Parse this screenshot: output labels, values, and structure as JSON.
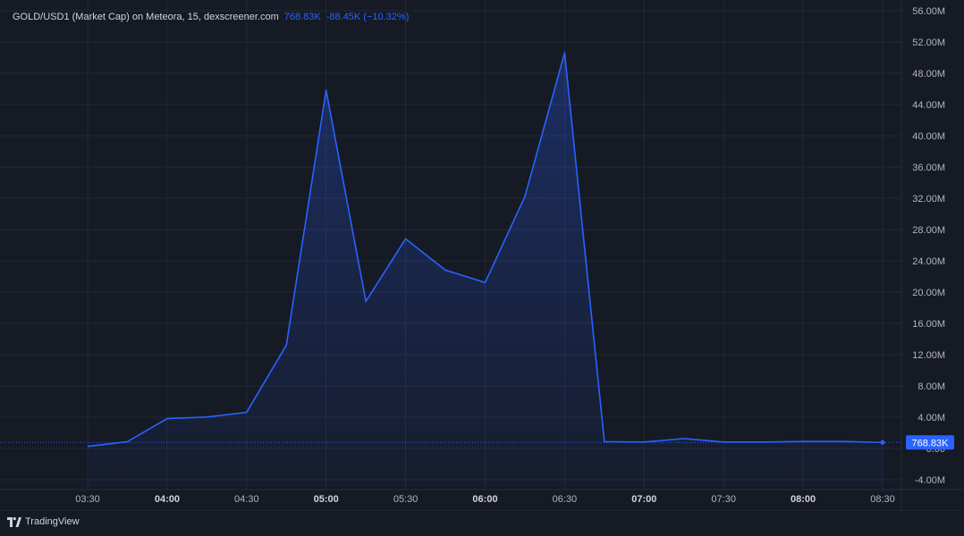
{
  "legend": {
    "symbol": "GOLD/USD1 (Market Cap) on Meteora, 15, dexscreener.com",
    "value": "768.83K",
    "change": "-88.45K (−10.32%)"
  },
  "brand": {
    "name": "TradingView"
  },
  "colors": {
    "background": "#161a25",
    "line": "#2962ff",
    "grid": "#232838",
    "axis_text": "#b2b5be",
    "price_label_bg": "#2962ff"
  },
  "chart_data": {
    "type": "area",
    "title": "",
    "x": [
      "03:30",
      "03:45",
      "04:00",
      "04:15",
      "04:30",
      "04:45",
      "05:00",
      "05:15",
      "05:30",
      "05:45",
      "06:00",
      "06:15",
      "06:30",
      "06:45",
      "07:00",
      "07:15",
      "07:30",
      "07:45",
      "08:00",
      "08:15",
      "08:30"
    ],
    "y_millions": [
      0.26,
      0.86,
      3.82,
      4.02,
      4.62,
      13.22,
      45.82,
      18.82,
      26.82,
      22.82,
      21.22,
      32.22,
      50.62,
      0.87,
      0.82,
      1.26,
      0.82,
      0.82,
      0.9,
      0.9,
      0.77
    ],
    "y_ticks": [
      "56.00M",
      "52.00M",
      "48.00M",
      "44.00M",
      "40.00M",
      "36.00M",
      "32.00M",
      "28.00M",
      "24.00M",
      "20.00M",
      "16.00M",
      "12.00M",
      "8.00M",
      "4.00M",
      "0.00",
      "-4.00M"
    ],
    "x_ticks": [
      {
        "label": "03:30",
        "bold": false
      },
      {
        "label": "04:00",
        "bold": true
      },
      {
        "label": "04:30",
        "bold": false
      },
      {
        "label": "05:00",
        "bold": true
      },
      {
        "label": "05:30",
        "bold": false
      },
      {
        "label": "06:00",
        "bold": true
      },
      {
        "label": "06:30",
        "bold": false
      },
      {
        "label": "07:00",
        "bold": true
      },
      {
        "label": "07:30",
        "bold": false
      },
      {
        "label": "08:00",
        "bold": true
      },
      {
        "label": "08:30",
        "bold": false
      }
    ],
    "ylim": [
      -5,
      57
    ],
    "last_value_label": "768.83K",
    "last_value_millions": 0.769,
    "grid": true
  }
}
